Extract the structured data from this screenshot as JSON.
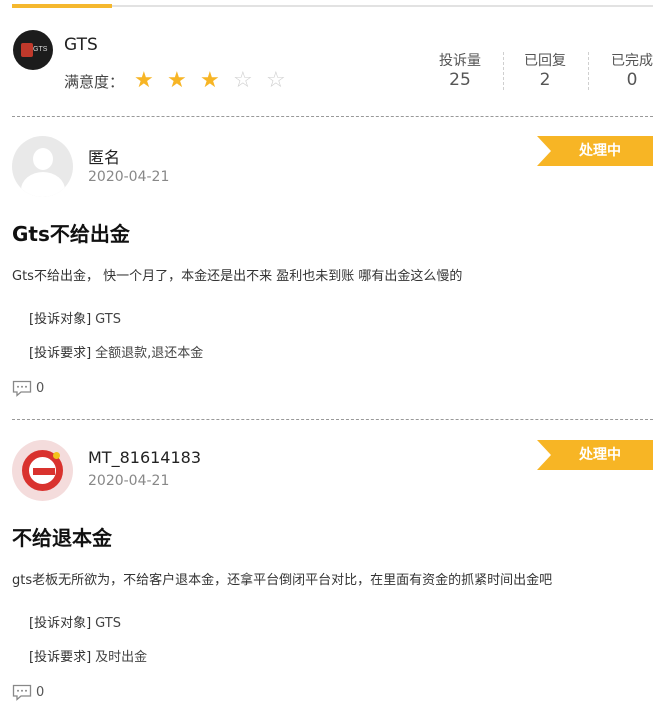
{
  "company": {
    "name": "GTS",
    "rating_label": "满意度：",
    "rating": 3,
    "rating_max": 5,
    "logo_text": "GTS"
  },
  "stats": [
    {
      "label": "投诉量",
      "value": "25"
    },
    {
      "label": "已回复",
      "value": "2"
    },
    {
      "label": "已完成",
      "value": "0"
    }
  ],
  "complaints": [
    {
      "user": "匿名",
      "date": "2020-04-21",
      "status": "处理中",
      "title": "Gts不给出金",
      "desc": "Gts不给出金， 快一个月了，本金还是出不来 盈利也未到账 哪有出金这么慢的",
      "target_label": "[投诉对象]",
      "target": "GTS",
      "demand_label": "[投诉要求]",
      "demand": "全额退款,退还本金",
      "comments": "0"
    },
    {
      "user": "MT_81614183",
      "date": "2020-04-21",
      "status": "处理中",
      "title": "不给退本金",
      "desc": "gts老板无所欲为，不给客户退本金，还拿平台倒闭平台对比，在里面有资金的抓紧时间出金吧",
      "target_label": "[投诉对象]",
      "target": "GTS",
      "demand_label": "[投诉要求]",
      "demand": "及时出金",
      "comments": "0"
    }
  ],
  "colors": {
    "accent": "#f7b525",
    "star_off": "#cfcfcf"
  }
}
